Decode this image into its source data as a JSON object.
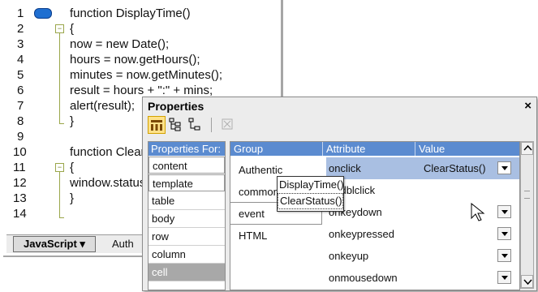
{
  "editor": {
    "line_numbers": [
      "1",
      "2",
      "3",
      "4",
      "5",
      "6",
      "7",
      "8",
      "9",
      "10",
      "11",
      "12",
      "13",
      "14"
    ],
    "lines": [
      {
        "t": "function DisplayTime()"
      },
      {
        "t": "{"
      },
      {
        "t": "now = new Date();"
      },
      {
        "t": "hours = now.getHours();"
      },
      {
        "t": "minutes = now.getMinutes();"
      },
      {
        "t": "result = hours + \":\" + mins;"
      },
      {
        "t": "alert(result);"
      },
      {
        "t": "}"
      },
      {
        "t": ""
      },
      {
        "t": "function ClearStatus()"
      },
      {
        "t": "{"
      },
      {
        "t": "window.status = \"\";"
      },
      {
        "t": "}"
      },
      {
        "t": ""
      }
    ],
    "language_button": "JavaScript ▾",
    "author_tab": "Auth"
  },
  "properties": {
    "title": "Properties",
    "close_label": "×",
    "left_header": "Properties For:",
    "left_items": [
      "content",
      "template",
      "table",
      "body",
      "row",
      "column",
      "cell"
    ],
    "columns": {
      "group": "Group",
      "attribute": "Attribute",
      "value": "Value"
    },
    "groups": [
      "Authentic",
      "common",
      "event",
      "HTML"
    ],
    "attributes": [
      "onclick",
      "ondblclick",
      "onkeydown",
      "onkeypressed",
      "onkeyup",
      "onmousedown"
    ],
    "selected_value": "ClearStatus()",
    "dropdown_options": [
      "DisplayTime()",
      "ClearStatus()"
    ]
  },
  "colors": {
    "header_blue": "#5b8bd0",
    "selection_blue": "#a9bfe2",
    "keyword_blue": "#1c3fa8"
  }
}
